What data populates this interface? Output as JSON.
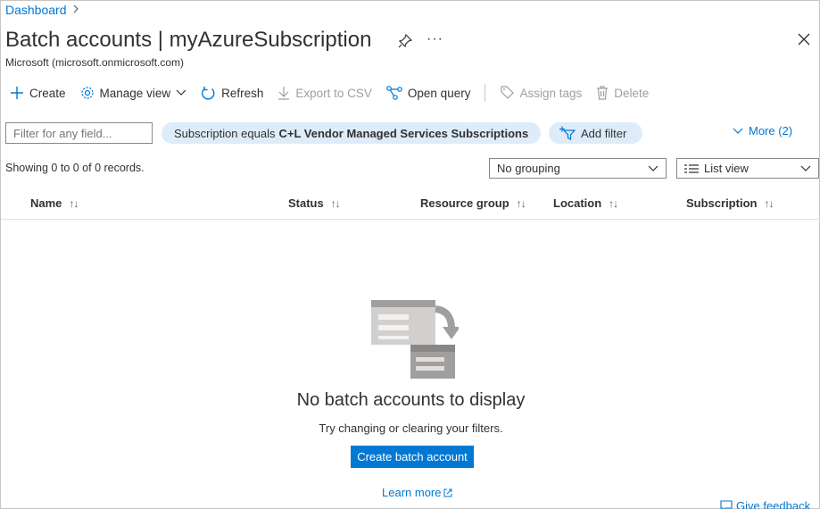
{
  "breadcrumb": {
    "home": "Dashboard",
    "separator": ">"
  },
  "header": {
    "title": "Batch accounts | myAzureSubscription",
    "subtitle": "Microsoft (microsoft.onmicrosoft.com)",
    "more": "···"
  },
  "toolbar": {
    "create": "Create",
    "manage_view": "Manage view",
    "refresh": "Refresh",
    "export_csv": "Export to CSV",
    "open_query": "Open query",
    "assign_tags": "Assign tags",
    "delete": "Delete"
  },
  "filters": {
    "search_placeholder": "Filter for any field...",
    "subscription_prefix": "Subscription equals",
    "subscription_value": "C+L Vendor Managed Services Subscriptions",
    "add_filter": "Add filter",
    "more": "More (2)"
  },
  "records": "Showing 0 to 0 of 0 records.",
  "grouping": {
    "selected": "No grouping"
  },
  "view": {
    "selected": "List view"
  },
  "columns": [
    {
      "label": "Name",
      "sort": "↑↓"
    },
    {
      "label": "Status",
      "sort": "↑↓"
    },
    {
      "label": "Resource group",
      "sort": "↑↓"
    },
    {
      "label": "Location",
      "sort": "↑↓"
    },
    {
      "label": "Subscription",
      "sort": "↑↓"
    }
  ],
  "empty": {
    "title": "No batch accounts to display",
    "subtitle": "Try changing or clearing your filters.",
    "button": "Create batch account",
    "learn_more": "Learn more"
  },
  "feedback": "Give feedback",
  "colors": {
    "accent": "#0078d4",
    "pill": "#deecf9",
    "disabled": "#a19f9d"
  }
}
